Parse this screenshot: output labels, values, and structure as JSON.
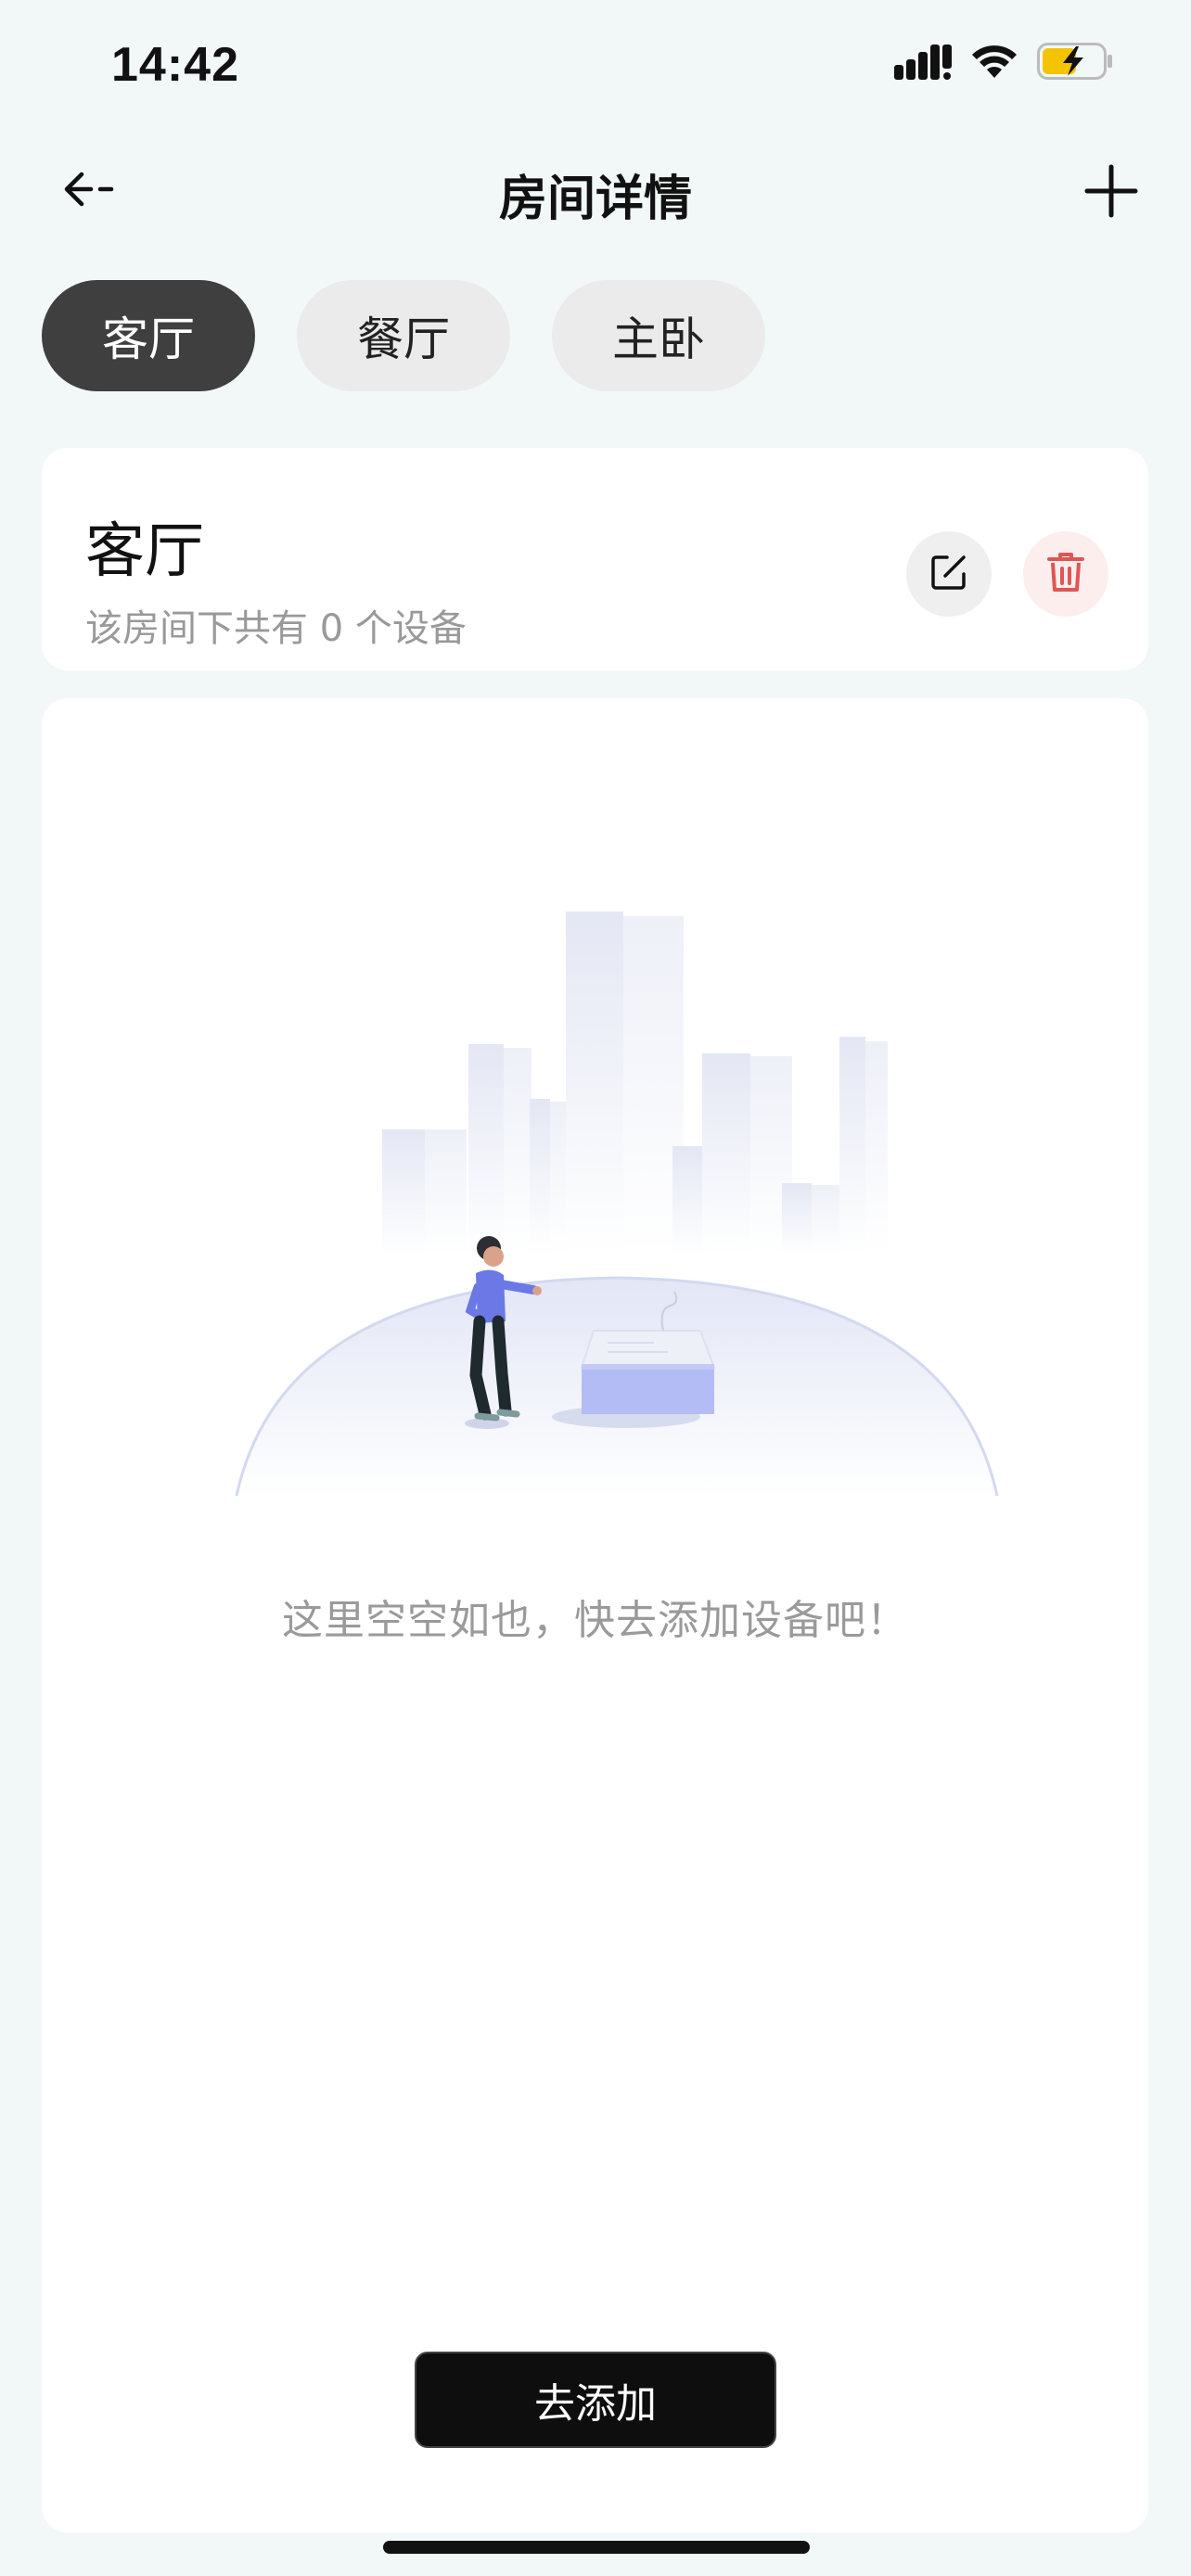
{
  "status_bar": {
    "time": "14:42",
    "icons": [
      "signal-icon",
      "wifi-icon",
      "battery-charging-icon"
    ]
  },
  "nav": {
    "title": "房间详情",
    "back_icon": "back-arrow-icon",
    "add_icon": "plus-icon"
  },
  "tabs": [
    {
      "label": "客厅",
      "active": true
    },
    {
      "label": "餐厅",
      "active": false
    },
    {
      "label": "主卧",
      "active": false
    }
  ],
  "room": {
    "name": "客厅",
    "device_count_text": "该房间下共有 0 个设备",
    "edit_icon": "edit-icon",
    "delete_icon": "trash-icon"
  },
  "empty_state": {
    "message": "这里空空如也，快去添加设备吧！",
    "button_label": "去添加"
  },
  "colors": {
    "background": "#f2f8f8",
    "active_tab": "#3f3f3f",
    "inactive_tab": "#ebebeb",
    "delete_red": "#e05555",
    "button_black": "#0e0e0e",
    "illustration_accent": "#b3bcf5"
  }
}
